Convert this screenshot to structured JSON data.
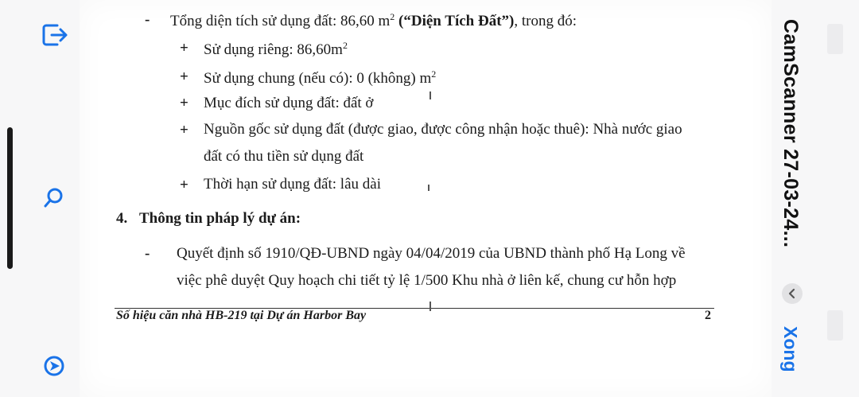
{
  "left_toolbar": {
    "icons": [
      "exit-icon",
      "search-icon",
      "navigate-icon"
    ]
  },
  "document": {
    "area_prefix": "Tổng diện tích sử dụng đất: 86,60 m",
    "area_sup": "2",
    "area_quote": "(“Diện Tích Đất”)",
    "area_suffix": ", trong đó:",
    "private_use_prefix": "Sử dụng riêng:  86,60m",
    "private_use_sup": "2",
    "shared_use_prefix": "Sử dụng chung (nếu có): 0 (không) m",
    "shared_use_sup": "2",
    "purpose": "Mục đích sử dụng đất: đất ở",
    "origin_line1": "Nguồn gốc sử dụng đất (được giao, được công nhận hoặc thuê): Nhà nước giao",
    "origin_line2": "đất có thu tiền sử dụng đất",
    "term": "Thời hạn sử dụng đất: lâu dài",
    "section_number": "4.",
    "section_title": "Thông tin pháp lý dự án:",
    "decision_line1": "Quyết định số 1910/QĐ-UBND ngày 04/04/2019 của UBND thành phố Hạ Long về",
    "decision_line2": "việc phê duyệt Quy hoạch chi tiết tỷ lệ 1/500 Khu nhà ở liên kế, chung cư hỗn hợp",
    "footer_text": "Số hiệu căn nhà HB-219 tại Dự án Harbor Bay",
    "page_number": "2",
    "bullet_dash": "-",
    "bullet_plus": "+"
  },
  "right_panel": {
    "title": "CamScanner 27-03-24...",
    "done_label": "Xong"
  },
  "colors": {
    "accent": "#1a73e8",
    "text": "#1b1b1b"
  }
}
